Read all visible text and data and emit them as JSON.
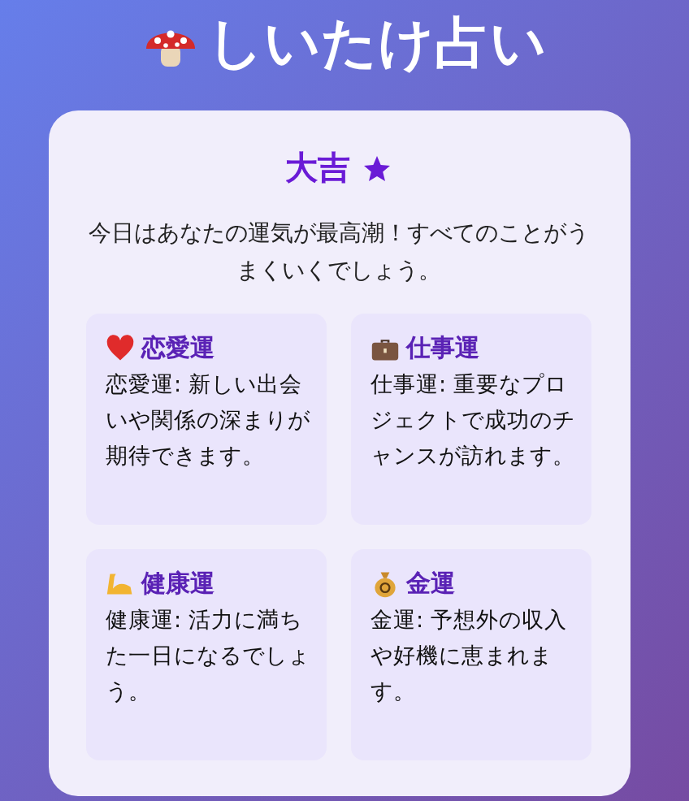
{
  "title": "しいたけ占い",
  "result": {
    "rank": "大吉",
    "message": "今日はあなたの運気が最高潮！すべてのことがうまくいくでしょう。"
  },
  "fortunes": [
    {
      "kind": "heart",
      "heading": "恋愛運",
      "text": "恋愛運: 新しい出会いや関係の深まりが期待できます。"
    },
    {
      "kind": "briefcase",
      "heading": "仕事運",
      "text": "仕事運: 重要なプロジェクトで成功のチャンスが訪れます。"
    },
    {
      "kind": "muscle",
      "heading": "健康運",
      "text": "健康運: 活力に満ちた一日になるでしょう。"
    },
    {
      "kind": "moneybag",
      "heading": "金運",
      "text": "金運: 予想外の収入や好機に恵まれます。"
    }
  ]
}
